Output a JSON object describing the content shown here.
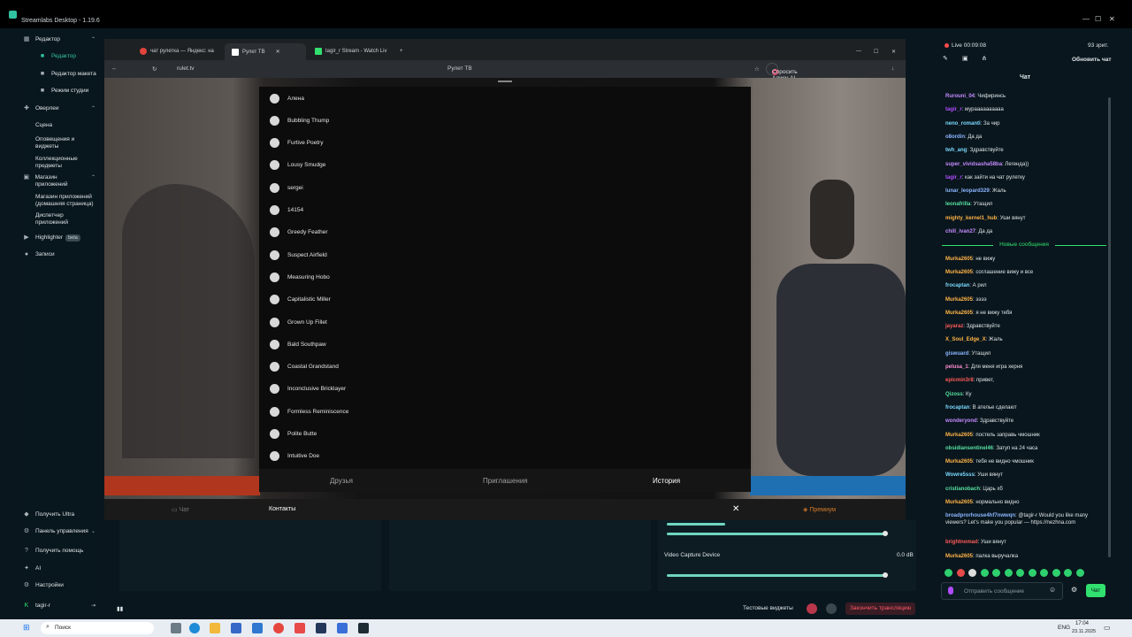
{
  "app": {
    "title": "Streamlabs Desktop - 1.19.6"
  },
  "sidebar": {
    "editor": "Редактор",
    "items": [
      "Редактор",
      "Редактор макета",
      "Режим студии"
    ],
    "overlays": "Оверлеи",
    "overlay_items": [
      "Сцена",
      "Оповещения и виджеты",
      "Коллекционные предметы"
    ],
    "appstore": "Магазин приложений",
    "appstore_items": [
      "Магазин приложений (домашняя страница)",
      "Диспетчер приложений"
    ],
    "highlighter": "Highlighter",
    "highlighter_badge": "beta",
    "recordings": "Записи",
    "bottom": [
      "Получить Ultra",
      "Панель управления",
      "Получить помощь",
      "AI",
      "Настройки"
    ],
    "user": "tagir-r"
  },
  "browser": {
    "tabs": [
      "чат рулетка — Яндекс: на",
      "Рулет ТВ",
      "tagir_r Stream - Watch Liv"
    ],
    "url": "rulet.tv",
    "page_title": "Рулет ТВ",
    "alice": "Спросить Алису AI"
  },
  "contacts": [
    "Алена",
    "Bubbling Thump",
    "Furtive Poetry",
    "Lousy Smudge",
    "sergei",
    "14154",
    "Greedy Feather",
    "Suspect Airfield",
    "Measuring Hobo",
    "Capitalistic Miller",
    "Grown Up Fillet",
    "Bald Southpaw",
    "Coastal Grandstand",
    "Inconclusive Bricklayer",
    "Formless Reminiscence",
    "Polite Butte",
    "Intuitive Doe"
  ],
  "modal_tabs": [
    "Друзья",
    "Приглашения",
    "История"
  ],
  "modal_footer": {
    "chat": "Чат",
    "contacts": "Контакты",
    "premium": "Премиум"
  },
  "mixer": {
    "device": "Video Capture Device",
    "db": "0.0 dB"
  },
  "bottom_bar": {
    "test": "Тестовые виджеты",
    "end": "Закончить трансляцию"
  },
  "live": {
    "status": "Live 00:09:08",
    "viewers": "93 зрит.",
    "refresh": "Обновить чат",
    "chat_title": "Чат"
  },
  "chat": [
    {
      "u": "Rurouni_04",
      "m": ": Чифиринсь",
      "c": "#c58bff"
    },
    {
      "u": "tagir_r",
      "m": ": мураааааааааа",
      "c": "#b04cff"
    },
    {
      "u": "neno_romanti",
      "m": ": За чир",
      "c": "#7ad9ff"
    },
    {
      "u": "o8ordin",
      "m": ": Да да",
      "c": "#8cb6ff"
    },
    {
      "u": "twh_ang",
      "m": ": Здравствуйте",
      "c": "#7ad9ff"
    },
    {
      "u": "super_vividsasha58ba",
      "m": ": Легенда))",
      "c": "#c58bff"
    },
    {
      "u": "tagir_r",
      "m": ": как зайти на чат рулетку",
      "c": "#b04cff"
    },
    {
      "u": "lunar_leopard329",
      "m": ": Жаль",
      "c": "#8cb6ff"
    },
    {
      "u": "leonafrilla",
      "m": ": Утащил",
      "c": "#57e0a0"
    },
    {
      "u": "mighty_kernel1_hub",
      "m": ": Уши вянут",
      "c": "#ffb347"
    },
    {
      "u": "chill_ivan27",
      "m": ": Да да",
      "c": "#c58bff"
    },
    {
      "u": "Murka2605",
      "m": ": не вижу",
      "c": "#ffb347"
    },
    {
      "u": "Murka2605",
      "m": ": соглашение вижу и все",
      "c": "#ffb347"
    },
    {
      "u": "frocaptan",
      "m": ": А рил",
      "c": "#7ad9ff"
    },
    {
      "u": "Murka2605",
      "m": ": ээээ",
      "c": "#ffb347"
    },
    {
      "u": "Murka2605",
      "m": ": я не вижу тебя",
      "c": "#ffb347"
    },
    {
      "u": "jayaraz",
      "m": ": Здравствуйте",
      "c": "#ff5a5a"
    },
    {
      "u": "X_Soul_Edge_X",
      "m": ": Жаль",
      "c": "#ffb347"
    },
    {
      "u": "giswuard",
      "m": ": Утащил",
      "c": "#8cb6ff"
    },
    {
      "u": "pelusa_1",
      "m": ": Для меня игра херня",
      "c": "#ff8cd1"
    },
    {
      "u": "epicmin3r8",
      "m": ": привет,",
      "c": "#ff5a5a"
    },
    {
      "u": "Qizoss",
      "m": ": Ку",
      "c": "#57e0a0"
    },
    {
      "u": "frocaptan",
      "m": ": В ателье сделают",
      "c": "#7ad9ff"
    },
    {
      "u": "wonderyond",
      "m": ": Здравствуйте",
      "c": "#c58bff"
    },
    {
      "u": "Murka2605",
      "m": ": постель заправь чмошник",
      "c": "#ffb347"
    },
    {
      "u": "obsidiansentinel46",
      "m": ": Затуп на 24 часа",
      "c": "#57e0a0"
    },
    {
      "u": "Murka2605",
      "m": ": тебя не видно чмошник",
      "c": "#ffb347"
    },
    {
      "u": "Wowre5sss",
      "m": ": Уши вянут",
      "c": "#7ad9ff"
    },
    {
      "u": "cristianobach",
      "m": ": Царь хб",
      "c": "#57e0a0"
    },
    {
      "u": "Murka2605",
      "m": ": нормально видно",
      "c": "#ffb347"
    },
    {
      "u": "broadprorhouse4hf7nwwqn",
      "m": ": @tagir-r Would you like many viewers? Let's make you popular — https://nezhna.com",
      "c": "#8cb6ff"
    },
    {
      "u": "brightnomad",
      "m": ": Уши вянут",
      "c": "#ff5a5a"
    },
    {
      "u": "Murka2605",
      "m": ": палка выручалка",
      "c": "#ffb347"
    }
  ],
  "new_messages": "Новые сообщения",
  "chat_input_placeholder": "Отправить сообщение",
  "send": "Чат",
  "taskbar": {
    "search": "Поиск",
    "lang": "ENG",
    "time": "17:04",
    "date": "23.11.2025"
  }
}
